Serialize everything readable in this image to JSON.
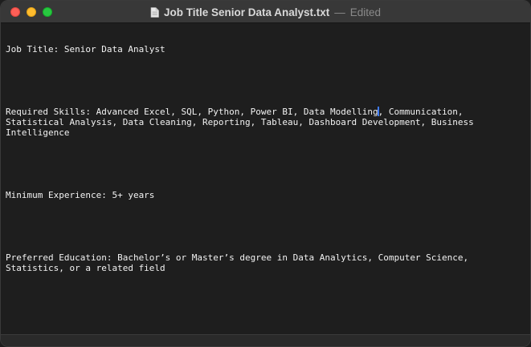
{
  "window": {
    "title": "Job Title Senior Data Analyst.txt",
    "separator": "—",
    "status": "Edited"
  },
  "document": {
    "line1": "Job Title: Senior Data Analyst",
    "skills_before_caret": "Required Skills: Advanced Excel, SQL, Python, Power BI, Data Modelling",
    "skills_after_caret": ", Communication, Statistical Analysis, Data Cleaning, Reporting, Tableau, Dashboard Development, Business Intelligence",
    "experience": "Minimum Experience: 5+ years",
    "education": "Preferred Education: Bachelor’s or Master’s degree in Data Analytics, Computer Science, Statistics, or a related field"
  }
}
